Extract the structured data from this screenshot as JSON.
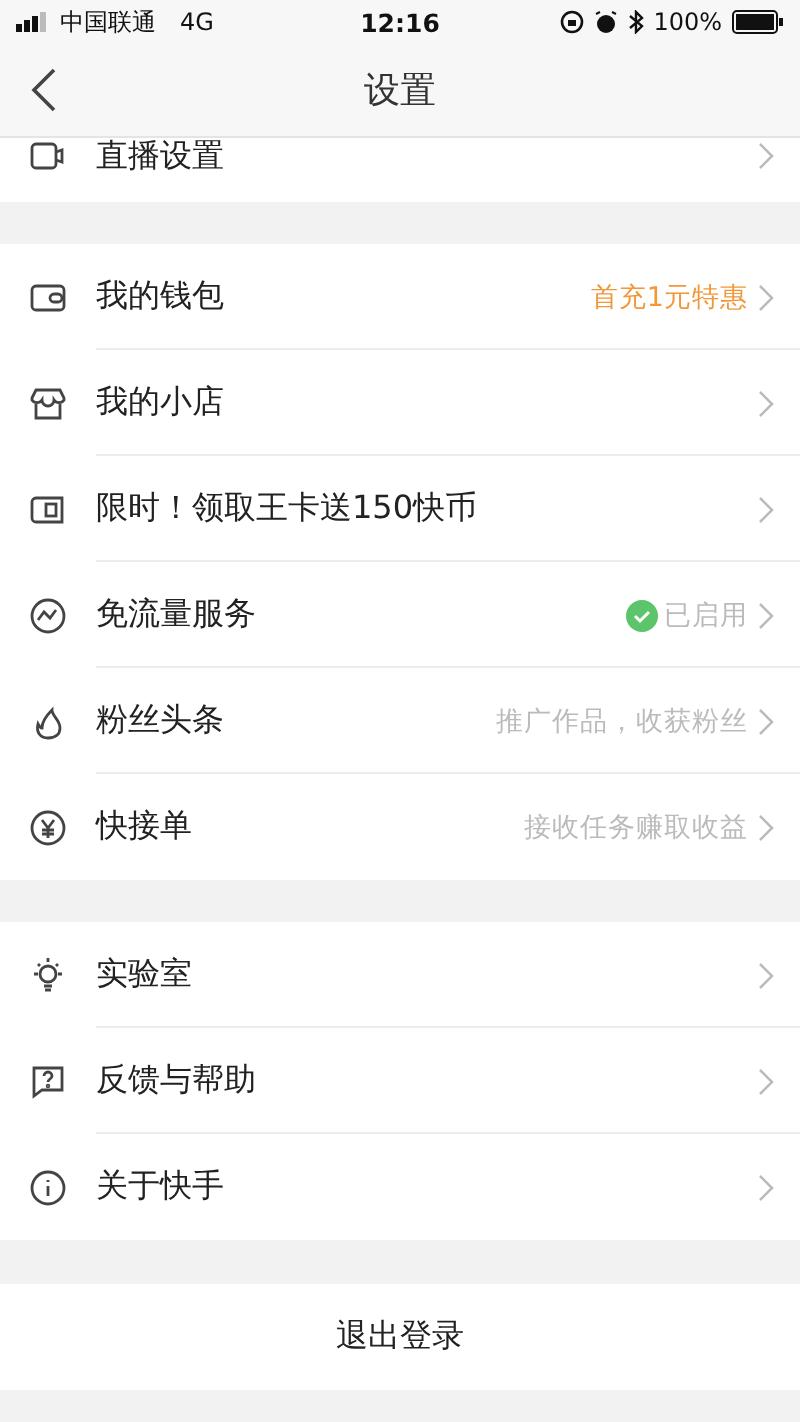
{
  "status_bar": {
    "carrier": "中国联通",
    "network": "4G",
    "time": "12:16",
    "battery": "100%"
  },
  "nav": {
    "title": "设置"
  },
  "sections": [
    {
      "rows": [
        {
          "label": "直播设置"
        }
      ]
    },
    {
      "rows": [
        {
          "label": "我的钱包",
          "note": {
            "kind": "promo",
            "text": "首充1元特惠"
          }
        },
        {
          "label": "我的小店"
        },
        {
          "label": "限时！领取王卡送150快币"
        },
        {
          "label": "免流量服务",
          "note": {
            "kind": "status",
            "text": "已启用"
          }
        },
        {
          "label": "粉丝头条",
          "note": {
            "kind": "hint",
            "text": "推广作品，收获粉丝"
          }
        },
        {
          "label": "快接单",
          "note": {
            "kind": "hint",
            "text": "接收任务赚取收益"
          }
        }
      ]
    },
    {
      "rows": [
        {
          "label": "实验室"
        },
        {
          "label": "反馈与帮助"
        },
        {
          "label": "关于快手"
        }
      ]
    }
  ],
  "logout": "退出登录"
}
